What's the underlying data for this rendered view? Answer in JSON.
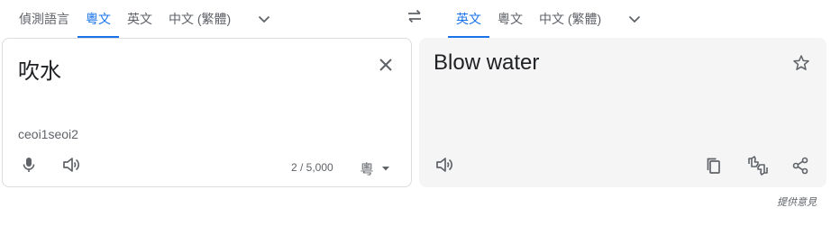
{
  "source_langs": [
    "偵測語言",
    "粵文",
    "英文",
    "中文 (繁體)"
  ],
  "target_langs": [
    "英文",
    "粵文",
    "中文 (繁體)"
  ],
  "source": {
    "text": "吹水",
    "romanization": "ceoi1seoi2",
    "char_count": "2 / 5,000",
    "ime_label": "粵"
  },
  "target": {
    "text": "Blow water"
  },
  "feedback_label": "提供意見",
  "colors": {
    "accent": "#1a73e8",
    "icon": "#5f6368",
    "target_panel_bg": "#f5f5f5"
  },
  "icons": [
    "chevron-down-icon",
    "swap-icon",
    "close-icon",
    "microphone-icon",
    "speaker-icon",
    "chevron-down-icon",
    "star-icon",
    "copy-icon",
    "thumbs-icon",
    "share-icon"
  ]
}
